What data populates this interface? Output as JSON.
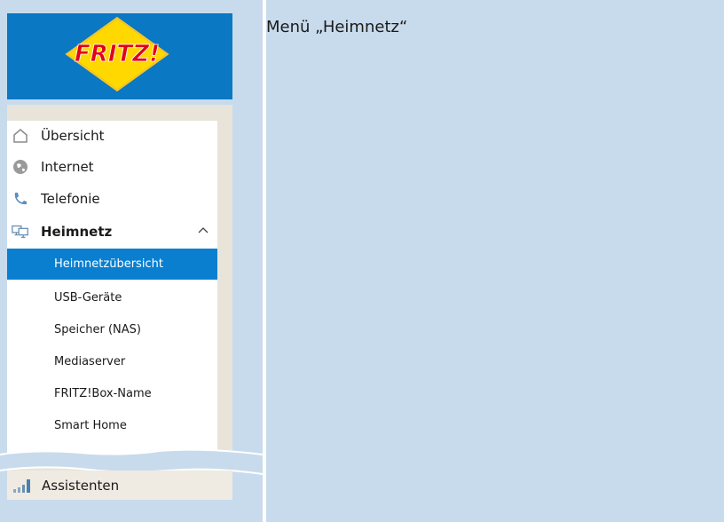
{
  "caption": "Menü „Heimnetz“",
  "logo_text": "FRITZ!",
  "nav": {
    "items": [
      {
        "label": "Übersicht",
        "icon": "home-icon"
      },
      {
        "label": "Internet",
        "icon": "globe-icon"
      },
      {
        "label": "Telefonie",
        "icon": "phone-icon"
      },
      {
        "label": "Heimnetz",
        "icon": "network-icon",
        "expanded": true
      }
    ],
    "subitems": [
      {
        "label": "Heimnetzübersicht",
        "selected": true
      },
      {
        "label": "USB-Geräte"
      },
      {
        "label": "Speicher (NAS)"
      },
      {
        "label": "Mediaserver"
      },
      {
        "label": "FRITZ!Box-Name"
      },
      {
        "label": "Smart Home"
      }
    ],
    "assistant_label": "Assistenten"
  },
  "colors": {
    "page_background": "#c8dbed",
    "header_blue": "#0a78c3",
    "selected_blue": "#0a7fcf",
    "logo_yellow": "#ffd800",
    "logo_red": "#e2001a"
  }
}
